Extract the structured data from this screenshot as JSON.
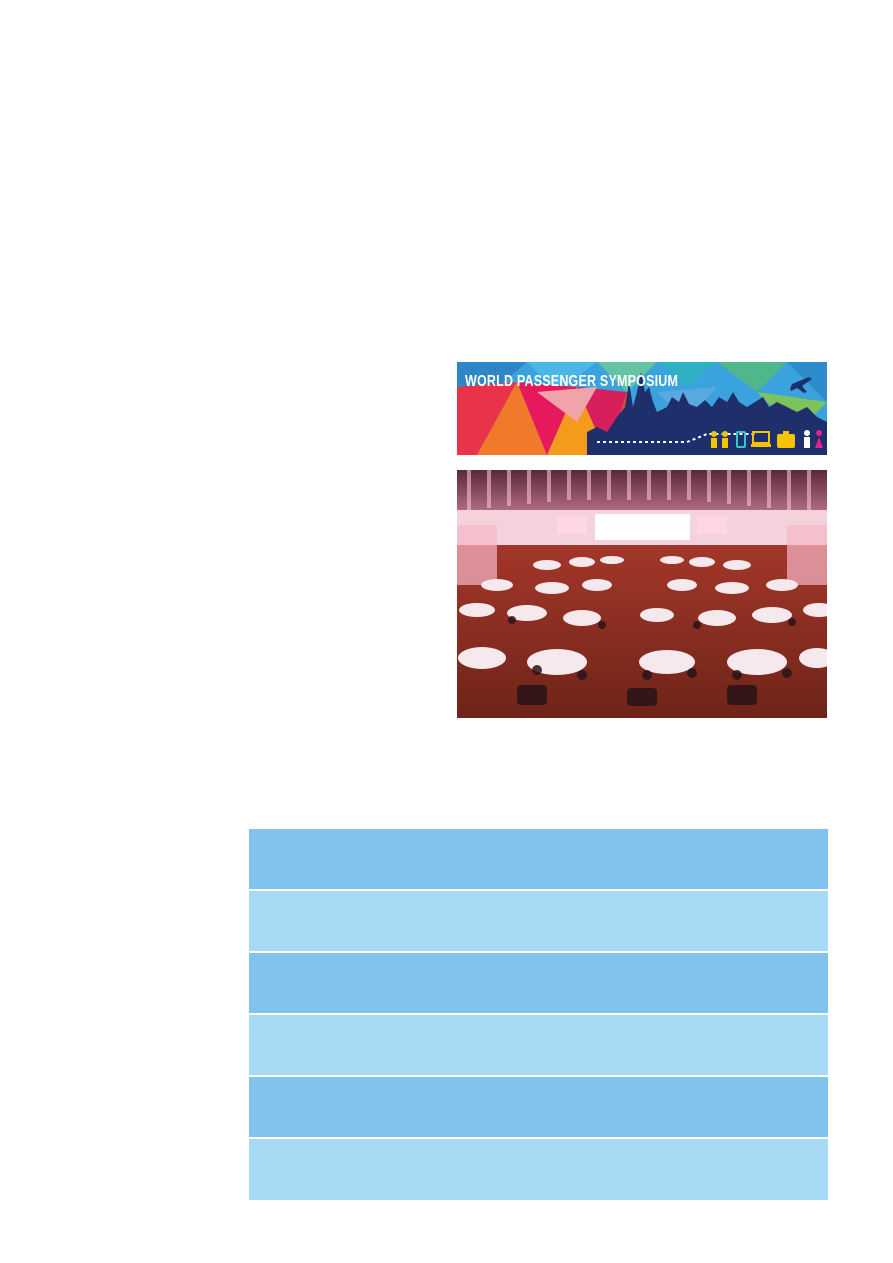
{
  "banner": {
    "title": "WORLD PASSENGER SYMPOSIUM",
    "icons": [
      "person-icon",
      "person-icon",
      "phone-icon",
      "laptop-icon",
      "luggage-icon",
      "person-icon",
      "person-icon",
      "airplane-icon"
    ]
  },
  "photo": {
    "subject": "conference-hall"
  },
  "table": {
    "rows": [
      {
        "shade": "dark"
      },
      {
        "shade": "light"
      },
      {
        "shade": "dark"
      },
      {
        "shade": "light"
      },
      {
        "shade": "dark"
      },
      {
        "shade": "light"
      }
    ],
    "colors": {
      "dark": "#81c3ec",
      "light": "#a8daf5"
    }
  }
}
